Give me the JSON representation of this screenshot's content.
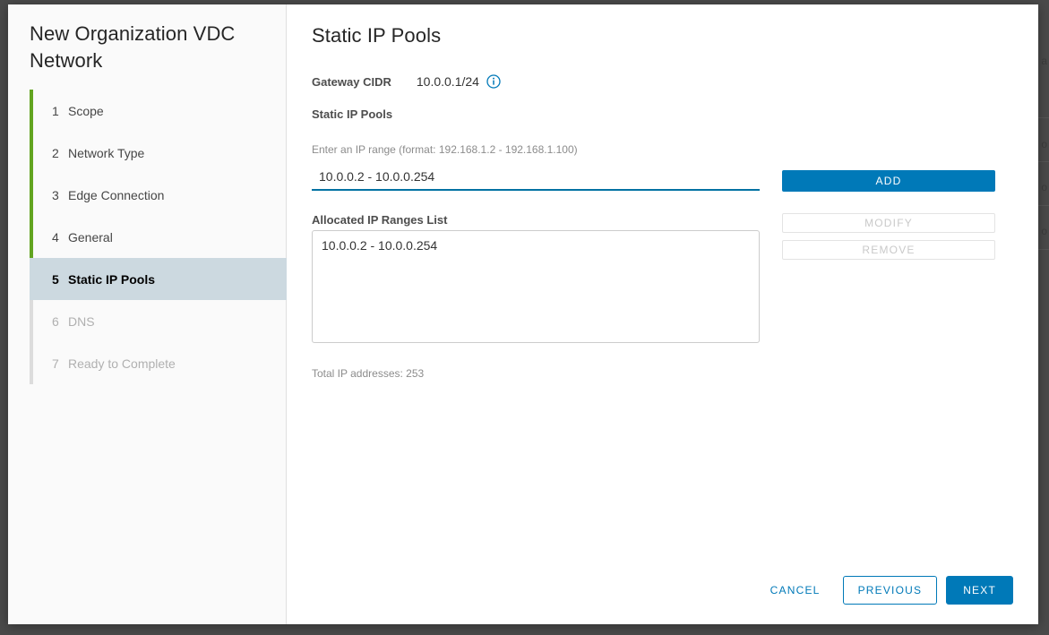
{
  "wizard": {
    "title": "New Organization VDC Network",
    "steps": [
      {
        "num": "1",
        "label": "Scope",
        "state": "done"
      },
      {
        "num": "2",
        "label": "Network Type",
        "state": "done"
      },
      {
        "num": "3",
        "label": "Edge Connection",
        "state": "done"
      },
      {
        "num": "4",
        "label": "General",
        "state": "done"
      },
      {
        "num": "5",
        "label": "Static IP Pools",
        "state": "active"
      },
      {
        "num": "6",
        "label": "DNS",
        "state": "disabled"
      },
      {
        "num": "7",
        "label": "Ready to Complete",
        "state": "disabled"
      }
    ]
  },
  "main": {
    "page_title": "Static IP Pools",
    "gateway": {
      "label": "Gateway CIDR",
      "value": "10.0.0.1/24",
      "info_icon": "info-circle-icon"
    },
    "pools_label": "Static IP Pools",
    "range_hint": "Enter an IP range (format: 192.168.1.2 - 192.168.1.100)",
    "range_input": {
      "value": "10.0.0.2 - 10.0.0.254",
      "placeholder": ""
    },
    "add_button": "ADD",
    "allocated_label": "Allocated IP Ranges List",
    "allocated_ranges": [
      "10.0.0.2 - 10.0.0.254"
    ],
    "modify_button": "MODIFY",
    "remove_button": "REMOVE",
    "total_ips": "Total IP addresses: 253"
  },
  "footer": {
    "cancel": "CANCEL",
    "previous": "PREVIOUS",
    "next": "NEXT"
  },
  "colors": {
    "accent": "#0079b8",
    "step_done": "#62a420",
    "step_active_bg": "#ccd9e0",
    "backdrop": "#4a4a4a"
  }
}
